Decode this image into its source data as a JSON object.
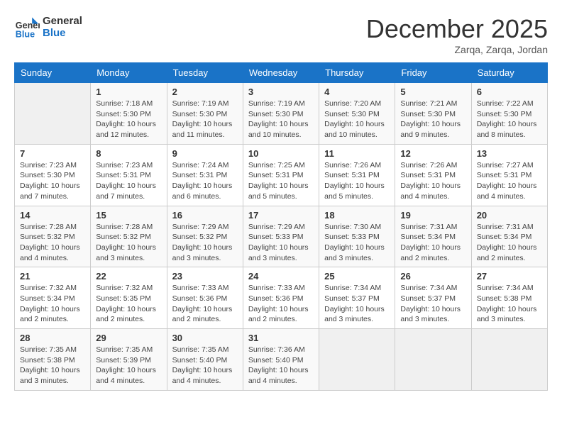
{
  "header": {
    "logo_line1": "General",
    "logo_line2": "Blue",
    "month": "December 2025",
    "location": "Zarqa, Zarqa, Jordan"
  },
  "weekdays": [
    "Sunday",
    "Monday",
    "Tuesday",
    "Wednesday",
    "Thursday",
    "Friday",
    "Saturday"
  ],
  "weeks": [
    [
      {
        "day": "",
        "info": ""
      },
      {
        "day": "1",
        "info": "Sunrise: 7:18 AM\nSunset: 5:30 PM\nDaylight: 10 hours\nand 12 minutes."
      },
      {
        "day": "2",
        "info": "Sunrise: 7:19 AM\nSunset: 5:30 PM\nDaylight: 10 hours\nand 11 minutes."
      },
      {
        "day": "3",
        "info": "Sunrise: 7:19 AM\nSunset: 5:30 PM\nDaylight: 10 hours\nand 10 minutes."
      },
      {
        "day": "4",
        "info": "Sunrise: 7:20 AM\nSunset: 5:30 PM\nDaylight: 10 hours\nand 10 minutes."
      },
      {
        "day": "5",
        "info": "Sunrise: 7:21 AM\nSunset: 5:30 PM\nDaylight: 10 hours\nand 9 minutes."
      },
      {
        "day": "6",
        "info": "Sunrise: 7:22 AM\nSunset: 5:30 PM\nDaylight: 10 hours\nand 8 minutes."
      }
    ],
    [
      {
        "day": "7",
        "info": "Sunrise: 7:23 AM\nSunset: 5:30 PM\nDaylight: 10 hours\nand 7 minutes."
      },
      {
        "day": "8",
        "info": "Sunrise: 7:23 AM\nSunset: 5:31 PM\nDaylight: 10 hours\nand 7 minutes."
      },
      {
        "day": "9",
        "info": "Sunrise: 7:24 AM\nSunset: 5:31 PM\nDaylight: 10 hours\nand 6 minutes."
      },
      {
        "day": "10",
        "info": "Sunrise: 7:25 AM\nSunset: 5:31 PM\nDaylight: 10 hours\nand 5 minutes."
      },
      {
        "day": "11",
        "info": "Sunrise: 7:26 AM\nSunset: 5:31 PM\nDaylight: 10 hours\nand 5 minutes."
      },
      {
        "day": "12",
        "info": "Sunrise: 7:26 AM\nSunset: 5:31 PM\nDaylight: 10 hours\nand 4 minutes."
      },
      {
        "day": "13",
        "info": "Sunrise: 7:27 AM\nSunset: 5:31 PM\nDaylight: 10 hours\nand 4 minutes."
      }
    ],
    [
      {
        "day": "14",
        "info": "Sunrise: 7:28 AM\nSunset: 5:32 PM\nDaylight: 10 hours\nand 4 minutes."
      },
      {
        "day": "15",
        "info": "Sunrise: 7:28 AM\nSunset: 5:32 PM\nDaylight: 10 hours\nand 3 minutes."
      },
      {
        "day": "16",
        "info": "Sunrise: 7:29 AM\nSunset: 5:32 PM\nDaylight: 10 hours\nand 3 minutes."
      },
      {
        "day": "17",
        "info": "Sunrise: 7:29 AM\nSunset: 5:33 PM\nDaylight: 10 hours\nand 3 minutes."
      },
      {
        "day": "18",
        "info": "Sunrise: 7:30 AM\nSunset: 5:33 PM\nDaylight: 10 hours\nand 3 minutes."
      },
      {
        "day": "19",
        "info": "Sunrise: 7:31 AM\nSunset: 5:34 PM\nDaylight: 10 hours\nand 2 minutes."
      },
      {
        "day": "20",
        "info": "Sunrise: 7:31 AM\nSunset: 5:34 PM\nDaylight: 10 hours\nand 2 minutes."
      }
    ],
    [
      {
        "day": "21",
        "info": "Sunrise: 7:32 AM\nSunset: 5:34 PM\nDaylight: 10 hours\nand 2 minutes."
      },
      {
        "day": "22",
        "info": "Sunrise: 7:32 AM\nSunset: 5:35 PM\nDaylight: 10 hours\nand 2 minutes."
      },
      {
        "day": "23",
        "info": "Sunrise: 7:33 AM\nSunset: 5:36 PM\nDaylight: 10 hours\nand 2 minutes."
      },
      {
        "day": "24",
        "info": "Sunrise: 7:33 AM\nSunset: 5:36 PM\nDaylight: 10 hours\nand 2 minutes."
      },
      {
        "day": "25",
        "info": "Sunrise: 7:34 AM\nSunset: 5:37 PM\nDaylight: 10 hours\nand 3 minutes."
      },
      {
        "day": "26",
        "info": "Sunrise: 7:34 AM\nSunset: 5:37 PM\nDaylight: 10 hours\nand 3 minutes."
      },
      {
        "day": "27",
        "info": "Sunrise: 7:34 AM\nSunset: 5:38 PM\nDaylight: 10 hours\nand 3 minutes."
      }
    ],
    [
      {
        "day": "28",
        "info": "Sunrise: 7:35 AM\nSunset: 5:38 PM\nDaylight: 10 hours\nand 3 minutes."
      },
      {
        "day": "29",
        "info": "Sunrise: 7:35 AM\nSunset: 5:39 PM\nDaylight: 10 hours\nand 4 minutes."
      },
      {
        "day": "30",
        "info": "Sunrise: 7:35 AM\nSunset: 5:40 PM\nDaylight: 10 hours\nand 4 minutes."
      },
      {
        "day": "31",
        "info": "Sunrise: 7:36 AM\nSunset: 5:40 PM\nDaylight: 10 hours\nand 4 minutes."
      },
      {
        "day": "",
        "info": ""
      },
      {
        "day": "",
        "info": ""
      },
      {
        "day": "",
        "info": ""
      }
    ]
  ]
}
